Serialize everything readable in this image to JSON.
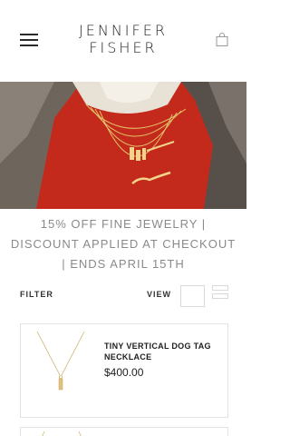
{
  "header": {
    "logo_line1": "JENNIFER",
    "logo_line2": "FISHER",
    "menu_icon": "hamburger-menu-icon",
    "bag_icon": "shopping-bag-icon"
  },
  "promo": {
    "line1": "15% OFF FINE JEWELRY |",
    "line2": "DISCOUNT APPLIED AT CHECKOUT",
    "line3": "| ENDS APRIL 15TH"
  },
  "toolbar": {
    "filter_label": "FILTER",
    "view_label": "VIEW"
  },
  "products": [
    {
      "title": "TINY VERTICAL DOG TAG NECKLACE",
      "price": "$400.00"
    }
  ],
  "colors": {
    "hero_red": "#c42a1c",
    "text_dark": "#1e1e1e",
    "promo_gray": "#8a8a8a",
    "border": "#e3e3e3"
  }
}
